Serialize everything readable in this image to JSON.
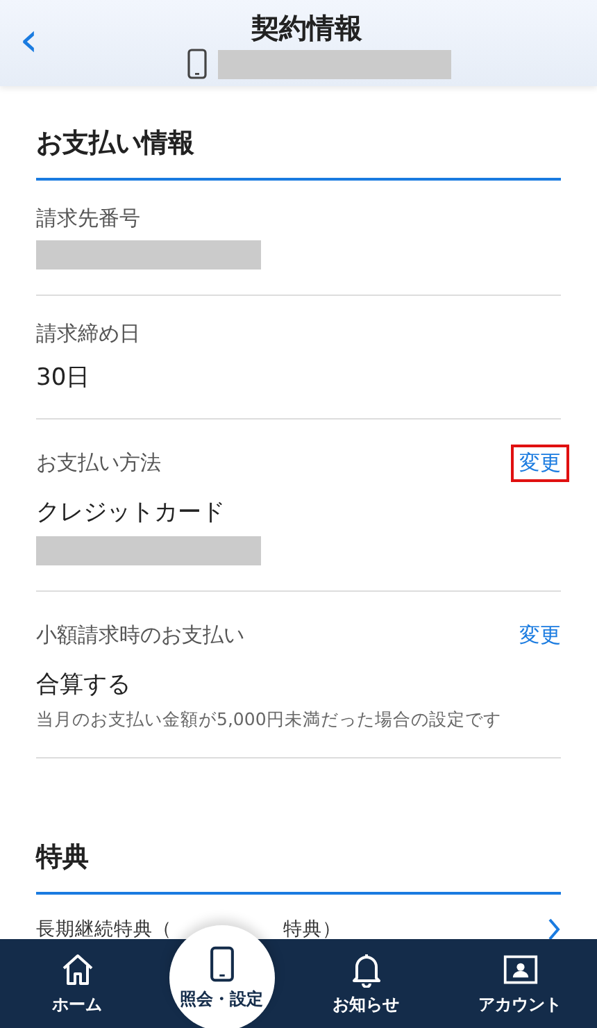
{
  "header": {
    "title": "契約情報",
    "back": "‹",
    "masked_number": true
  },
  "sections": [
    {
      "title": "お支払い情報",
      "items": [
        {
          "label": "請求先番号",
          "masked": true
        },
        {
          "label": "請求締め日",
          "value": "30日"
        },
        {
          "label": "お支払い方法",
          "action": "変更",
          "highlighted": true,
          "value": "クレジットカード",
          "masked": true
        },
        {
          "label": "小額請求時のお支払い",
          "action": "変更",
          "highlighted": false,
          "value": "合算する",
          "note": "当月のお支払い金額が5,000円未満だった場合の設定です"
        }
      ]
    },
    {
      "title": "特典",
      "links": [
        {
          "label": "長期継続特典（",
          "label_tail": "特典）"
        }
      ]
    }
  ],
  "nav": [
    {
      "label": "ホーム",
      "selected": false
    },
    {
      "label": "照会・設定",
      "selected": true
    },
    {
      "label": "お知らせ",
      "selected": false
    },
    {
      "label": "アカウント",
      "selected": false
    }
  ]
}
